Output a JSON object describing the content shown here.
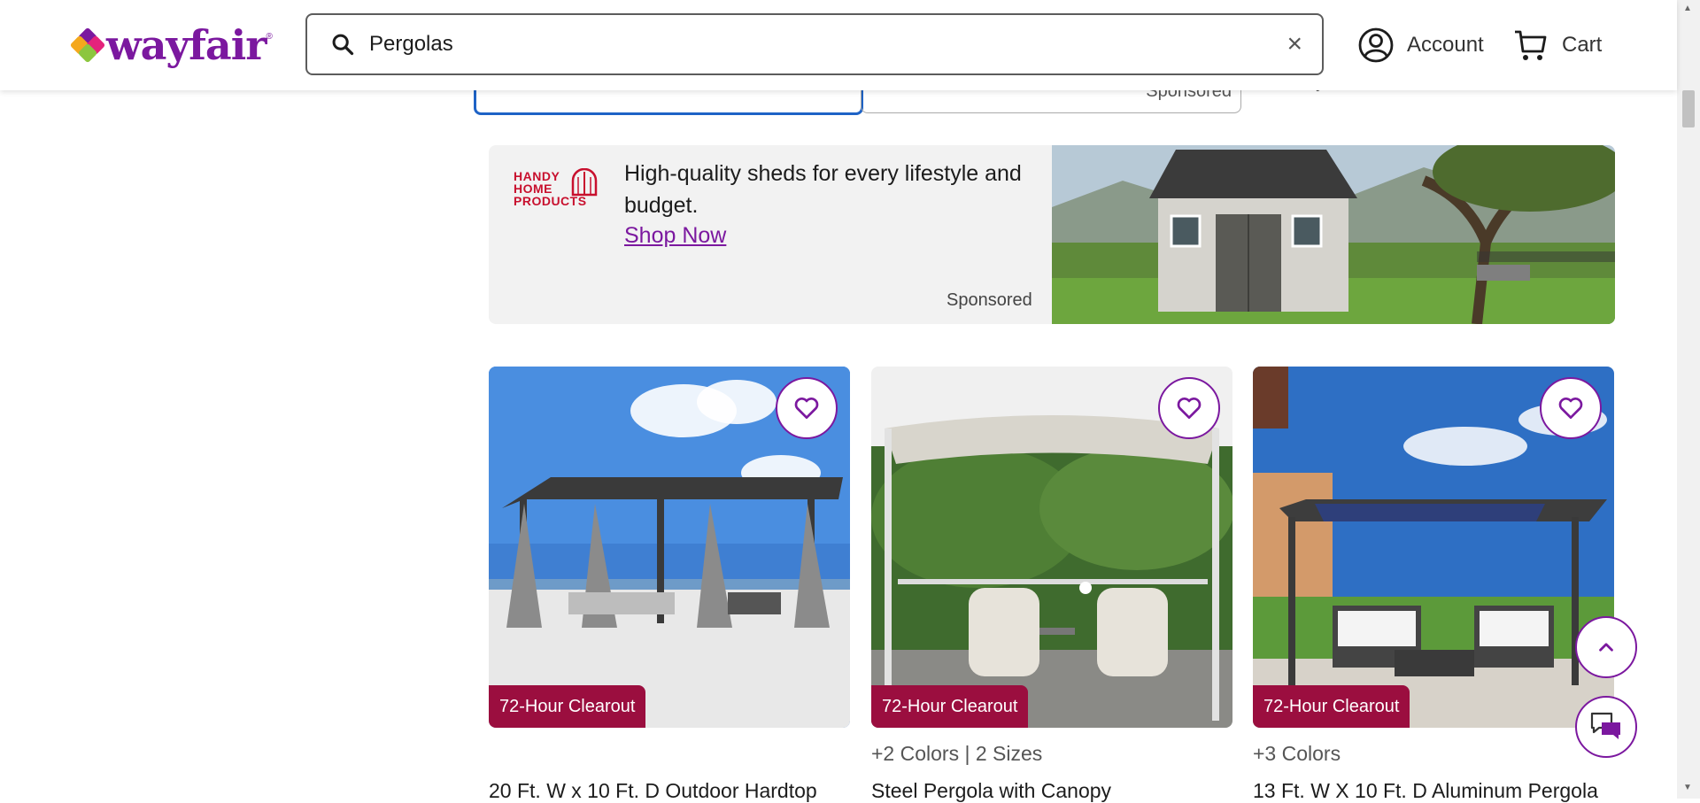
{
  "header": {
    "logo_text": "wayfair",
    "logo_tm": "®",
    "search_value": "Pergolas",
    "clear_symbol": "×",
    "account_label": "Account",
    "cart_label": "Cart"
  },
  "filters": {
    "sponsored_label": "Sponsored",
    "fragment_text": ", y"
  },
  "ad": {
    "brand": "HANDY HOME PRODUCTS",
    "brand_lines": [
      "HANDY",
      "HOME",
      "PRODUCTS"
    ],
    "text": "High-quality sheds for every lifestyle and budget.",
    "link": "Shop Now",
    "sponsored": "Sponsored"
  },
  "products": [
    {
      "badge": "72-Hour Clearout",
      "meta": "",
      "title": "20 Ft. W x 10 Ft. D Outdoor Hardtop"
    },
    {
      "badge": "72-Hour Clearout",
      "meta": "+2 Colors | 2 Sizes",
      "title": "Steel Pergola with Canopy"
    },
    {
      "badge": "72-Hour Clearout",
      "meta": "+3 Colors",
      "title": "13 Ft. W X 10 Ft. D Aluminum Pergola"
    }
  ],
  "icons": {
    "search": "search-icon",
    "clear": "close-icon",
    "account": "account-circle-icon",
    "cart": "cart-icon",
    "favorite": "heart-icon",
    "back_to_top": "chevron-up-icon",
    "chat": "chat-icon"
  },
  "colors": {
    "brand": "#7b189f",
    "badge": "#9b0e3f",
    "focus": "#1e63c6",
    "ad_brand": "#c8102e"
  }
}
